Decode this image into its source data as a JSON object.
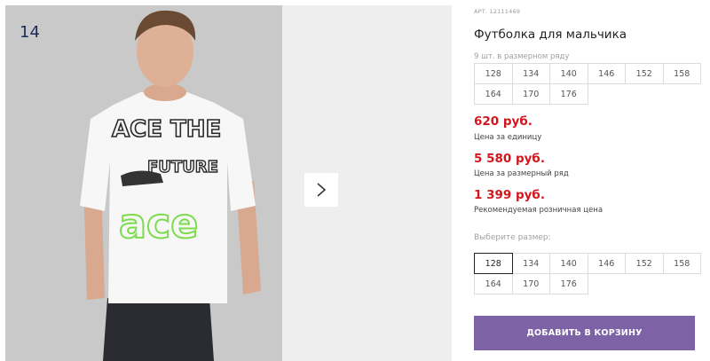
{
  "gallery": {
    "photo_index": "14",
    "next_icon": "chevron-right-icon"
  },
  "product": {
    "article": "АРТ. 12111469",
    "title": "Футболка для мальчика",
    "grid_note": "9 шт. в размерном ряду",
    "grid_sizes": [
      "128",
      "134",
      "140",
      "146",
      "152",
      "158",
      "164",
      "170",
      "176"
    ],
    "prices": [
      {
        "value": "620 руб.",
        "label": "Цена за единицу"
      },
      {
        "value": "5 580 руб.",
        "label": "Цена за размерный ряд"
      },
      {
        "value": "1 399 руб.",
        "label": "Рекомендуемая розничная цена"
      }
    ],
    "choose_label": "Выберите размер:",
    "choose_sizes": [
      "128",
      "134",
      "140",
      "146",
      "152",
      "158",
      "164",
      "170",
      "176"
    ],
    "selected_size": "128",
    "cart_button": "ДОБАВИТЬ В КОРЗИНУ"
  },
  "colors": {
    "price": "#d3161d",
    "button": "#7d62a6"
  }
}
